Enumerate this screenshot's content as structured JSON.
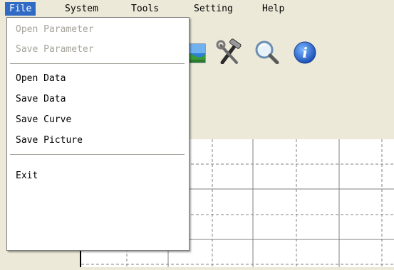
{
  "menubar": {
    "items": [
      {
        "label": "File",
        "active": true
      },
      {
        "label": "System",
        "active": false
      },
      {
        "label": "Tools",
        "active": false
      },
      {
        "label": "Setting",
        "active": false
      },
      {
        "label": "Help",
        "active": false
      }
    ]
  },
  "file_menu": {
    "items": [
      {
        "label": "Open Parameter",
        "enabled": false
      },
      {
        "label": "Save Parameter",
        "enabled": false
      },
      {
        "label": "Open Data",
        "enabled": true
      },
      {
        "label": "Save Data",
        "enabled": true
      },
      {
        "label": "Save Curve",
        "enabled": true
      },
      {
        "label": "Save Picture",
        "enabled": true
      },
      {
        "label": "Exit",
        "enabled": true
      }
    ]
  },
  "toolbar": {
    "icons": [
      "picture-icon",
      "tools-icon",
      "magnifier-icon",
      "info-icon"
    ],
    "info_glyph": "i"
  },
  "colors": {
    "menu_highlight": "#316ac5",
    "disabled_text": "#a5a39b",
    "grid_line": "#808080"
  }
}
